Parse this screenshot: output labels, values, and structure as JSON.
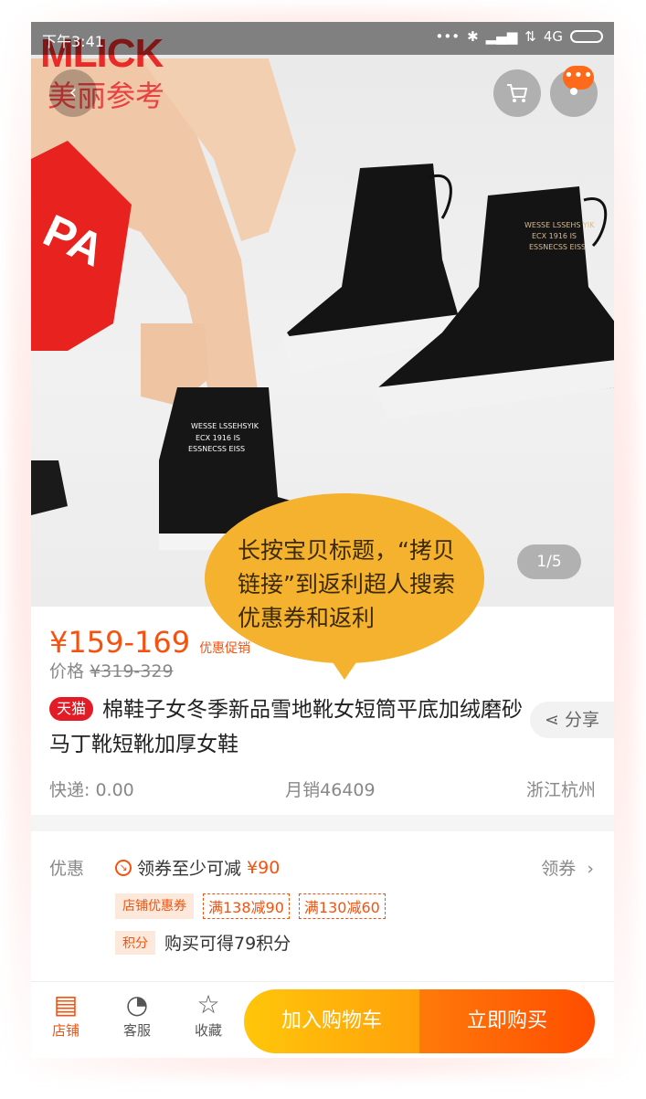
{
  "status": {
    "time": "下午3:41",
    "network": "4G",
    "dots": "•••"
  },
  "watermark": {
    "en": "MLICK",
    "cn": "美丽参考"
  },
  "hero": {
    "page_indicator": "1/5",
    "more_icon": "•••",
    "cart_icon": "cart-icon"
  },
  "tooltip": {
    "text": "长按宝贝标题，“拷贝链接”到返利超人搜索优惠券和返利"
  },
  "product": {
    "price": "¥159-169",
    "promo_label": "优惠促销",
    "original_prefix": "价格",
    "original_price": "¥319-329",
    "badge": "天猫",
    "title": "棉鞋子女冬季新品雪地靴女短筒平底加绒磨砂马丁靴短靴加厚女鞋",
    "share_label": "分享",
    "shipping": "快递: 0.00",
    "monthly_sales": "月销46409",
    "location": "浙江杭州"
  },
  "coupons": {
    "label": "优惠",
    "main_text": "领券至少可减",
    "main_amount": "¥90",
    "get_label": "领券",
    "store_tag": "店铺优惠券",
    "tags": [
      "满138减90",
      "满130减60"
    ],
    "points_tag": "积分",
    "points_text": "购买可得79积分"
  },
  "bottom_bar": {
    "store_label": "店铺",
    "service_label": "客服",
    "favorite_label": "收藏",
    "add_cart_label": "加入购物车",
    "buy_label": "立即购买"
  },
  "colors": {
    "accent": "#f6520f",
    "tmall": "#e31b26",
    "bubble": "#f5b22e"
  }
}
